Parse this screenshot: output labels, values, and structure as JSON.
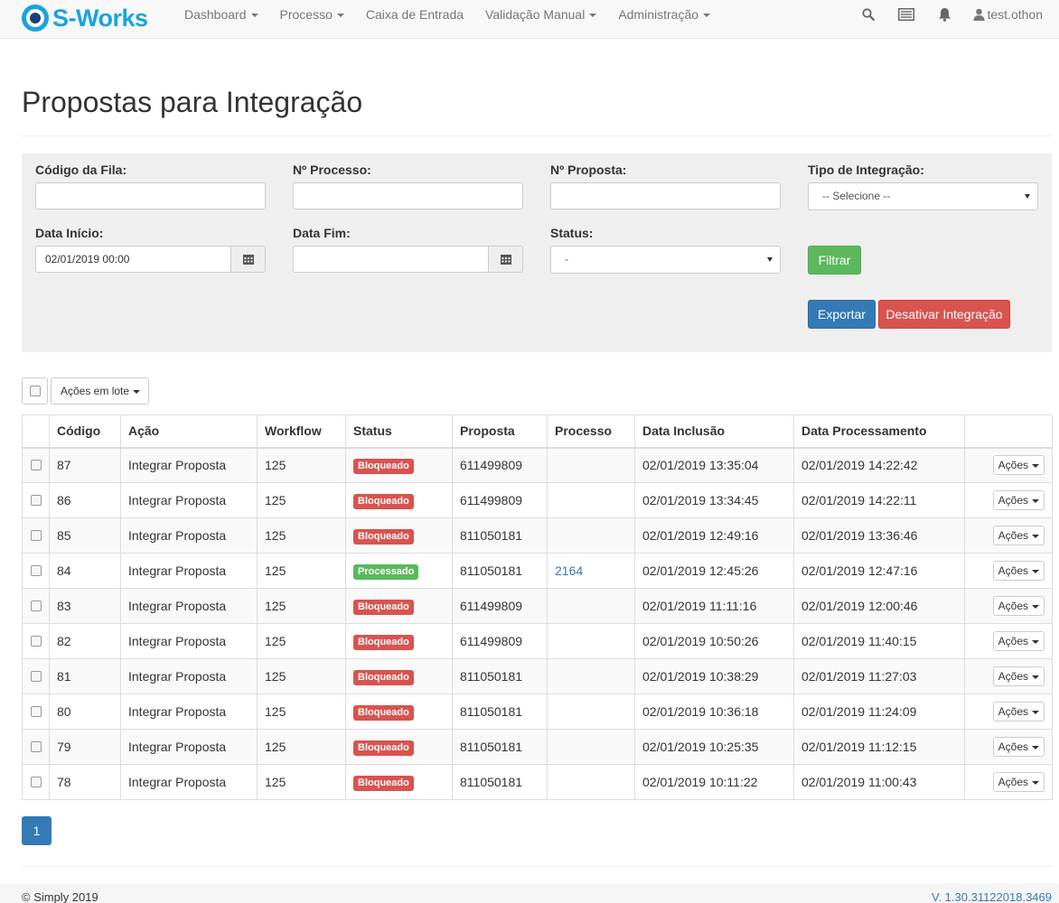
{
  "brand": {
    "name": "S-Works"
  },
  "nav": {
    "items": [
      {
        "label": "Dashboard",
        "dropdown": true
      },
      {
        "label": "Processo",
        "dropdown": true
      },
      {
        "label": "Caixa de Entrada",
        "dropdown": false
      },
      {
        "label": "Validação Manual",
        "dropdown": true
      },
      {
        "label": "Administração",
        "dropdown": true
      }
    ],
    "user": "test.othon"
  },
  "page": {
    "title": "Propostas para Integração"
  },
  "filters": {
    "codigo_fila": {
      "label": "Código da Fila:",
      "value": ""
    },
    "processo": {
      "label": "Nº Processo:",
      "value": ""
    },
    "proposta": {
      "label": "Nº Proposta:",
      "value": ""
    },
    "tipo": {
      "label": "Tipo de Integração:",
      "value": "-- Selecione --"
    },
    "data_inicio": {
      "label": "Data Início:",
      "value": "02/01/2019 00:00"
    },
    "data_fim": {
      "label": "Data Fim:",
      "value": ""
    },
    "status": {
      "label": "Status:",
      "value": "-"
    },
    "filtrar": "Filtrar",
    "exportar": "Exportar",
    "desativar": "Desativar Integração"
  },
  "bulk": {
    "label": "Ações em lote"
  },
  "table": {
    "columns": [
      "Código",
      "Ação",
      "Workflow",
      "Status",
      "Proposta",
      "Processo",
      "Data Inclusão",
      "Data Processamento"
    ],
    "action_label": "Ações",
    "rows": [
      {
        "codigo": "87",
        "acao": "Integrar Proposta",
        "workflow": "125",
        "status": "Bloqueado",
        "proposta": "611499809",
        "processo": "",
        "inclusao": "02/01/2019 13:35:04",
        "processamento": "02/01/2019 14:22:42"
      },
      {
        "codigo": "86",
        "acao": "Integrar Proposta",
        "workflow": "125",
        "status": "Bloqueado",
        "proposta": "611499809",
        "processo": "",
        "inclusao": "02/01/2019 13:34:45",
        "processamento": "02/01/2019 14:22:11"
      },
      {
        "codigo": "85",
        "acao": "Integrar Proposta",
        "workflow": "125",
        "status": "Bloqueado",
        "proposta": "811050181",
        "processo": "",
        "inclusao": "02/01/2019 12:49:16",
        "processamento": "02/01/2019 13:36:46"
      },
      {
        "codigo": "84",
        "acao": "Integrar Proposta",
        "workflow": "125",
        "status": "Processado",
        "proposta": "811050181",
        "processo": "2164",
        "inclusao": "02/01/2019 12:45:26",
        "processamento": "02/01/2019 12:47:16"
      },
      {
        "codigo": "83",
        "acao": "Integrar Proposta",
        "workflow": "125",
        "status": "Bloqueado",
        "proposta": "611499809",
        "processo": "",
        "inclusao": "02/01/2019 11:11:16",
        "processamento": "02/01/2019 12:00:46"
      },
      {
        "codigo": "82",
        "acao": "Integrar Proposta",
        "workflow": "125",
        "status": "Bloqueado",
        "proposta": "611499809",
        "processo": "",
        "inclusao": "02/01/2019 10:50:26",
        "processamento": "02/01/2019 11:40:15"
      },
      {
        "codigo": "81",
        "acao": "Integrar Proposta",
        "workflow": "125",
        "status": "Bloqueado",
        "proposta": "811050181",
        "processo": "",
        "inclusao": "02/01/2019 10:38:29",
        "processamento": "02/01/2019 11:27:03"
      },
      {
        "codigo": "80",
        "acao": "Integrar Proposta",
        "workflow": "125",
        "status": "Bloqueado",
        "proposta": "811050181",
        "processo": "",
        "inclusao": "02/01/2019 10:36:18",
        "processamento": "02/01/2019 11:24:09"
      },
      {
        "codigo": "79",
        "acao": "Integrar Proposta",
        "workflow": "125",
        "status": "Bloqueado",
        "proposta": "811050181",
        "processo": "",
        "inclusao": "02/01/2019 10:25:35",
        "processamento": "02/01/2019 11:12:15"
      },
      {
        "codigo": "78",
        "acao": "Integrar Proposta",
        "workflow": "125",
        "status": "Bloqueado",
        "proposta": "811050181",
        "processo": "",
        "inclusao": "02/01/2019 10:11:22",
        "processamento": "02/01/2019 11:00:43"
      }
    ]
  },
  "status_colors": {
    "Bloqueado": "#d9534f",
    "Processado": "#5cb85c"
  },
  "pagination": {
    "current": "1"
  },
  "footer": {
    "copyright": "© Simply 2019",
    "version": "V. 1.30.31122018.3469"
  }
}
